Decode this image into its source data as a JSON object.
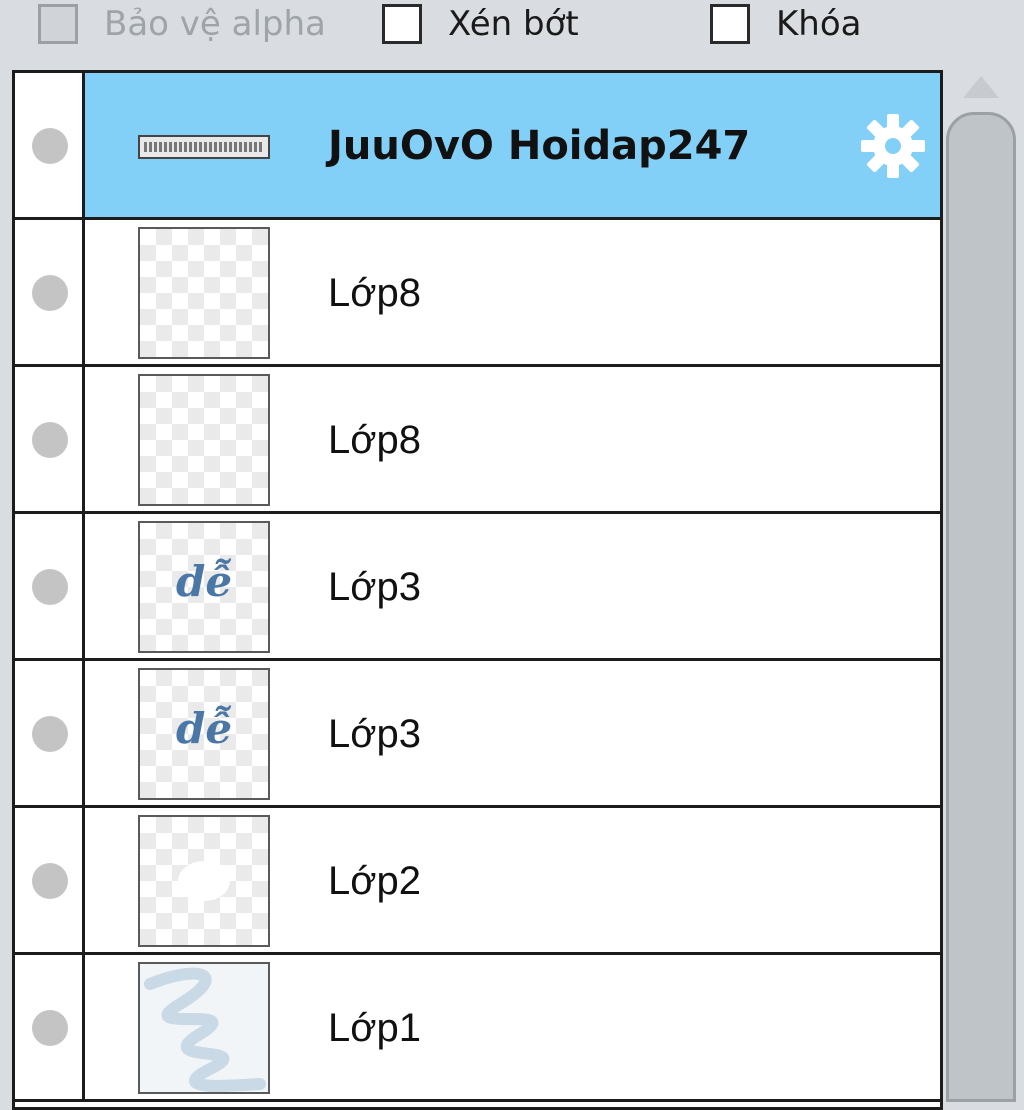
{
  "options": {
    "alpha_protect": {
      "label": "Bảo vệ alpha",
      "checked": false,
      "enabled": false
    },
    "clipping": {
      "label": "Xén bớt",
      "checked": false,
      "enabled": true
    },
    "lock": {
      "label": "Khóa",
      "checked": false,
      "enabled": true
    }
  },
  "layers": [
    {
      "name": "JuuOvO Hoidap247",
      "selected": true,
      "kind": "text",
      "icon": "gear-icon"
    },
    {
      "name": "Lớp8",
      "selected": false,
      "kind": "empty"
    },
    {
      "name": "Lớp8",
      "selected": false,
      "kind": "empty"
    },
    {
      "name": "Lớp3",
      "selected": false,
      "kind": "text-art",
      "thumb_text": "dễ"
    },
    {
      "name": "Lớp3",
      "selected": false,
      "kind": "text-art",
      "thumb_text": "dễ"
    },
    {
      "name": "Lớp2",
      "selected": false,
      "kind": "empty"
    },
    {
      "name": "Lớp1",
      "selected": false,
      "kind": "paint"
    }
  ],
  "colors": {
    "selected_row": "#82cff7",
    "thumb_text": "#4b77a6"
  }
}
